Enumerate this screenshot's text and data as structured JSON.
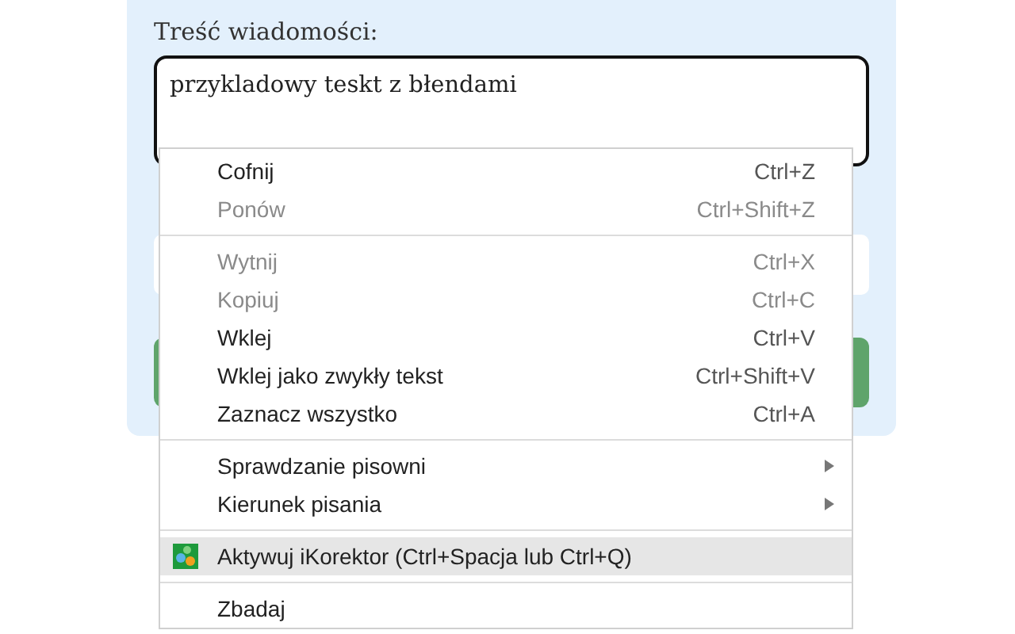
{
  "form": {
    "label": "Treść wiadomości:",
    "value": "przykladowy teskt z błendami"
  },
  "context_menu": {
    "items": [
      {
        "kind": "item",
        "label": "Cofnij",
        "shortcut": "Ctrl+Z",
        "disabled": false
      },
      {
        "kind": "item",
        "label": "Ponów",
        "shortcut": "Ctrl+Shift+Z",
        "disabled": true
      },
      {
        "kind": "separator"
      },
      {
        "kind": "item",
        "label": "Wytnij",
        "shortcut": "Ctrl+X",
        "disabled": true
      },
      {
        "kind": "item",
        "label": "Kopiuj",
        "shortcut": "Ctrl+C",
        "disabled": true
      },
      {
        "kind": "item",
        "label": "Wklej",
        "shortcut": "Ctrl+V",
        "disabled": false
      },
      {
        "kind": "item",
        "label": "Wklej jako zwykły tekst",
        "shortcut": "Ctrl+Shift+V",
        "disabled": false
      },
      {
        "kind": "item",
        "label": "Zaznacz wszystko",
        "shortcut": "Ctrl+A",
        "disabled": false
      },
      {
        "kind": "separator"
      },
      {
        "kind": "submenu",
        "label": "Sprawdzanie pisowni"
      },
      {
        "kind": "submenu",
        "label": "Kierunek pisania"
      },
      {
        "kind": "separator"
      },
      {
        "kind": "extension",
        "label": "Aktywuj iKorektor (Ctrl+Spacja lub Ctrl+Q)",
        "selected": true
      },
      {
        "kind": "separator"
      },
      {
        "kind": "item",
        "label": "Zbadaj",
        "disabled": false
      }
    ]
  }
}
